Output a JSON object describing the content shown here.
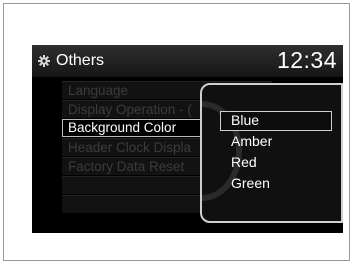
{
  "header": {
    "title": "Others",
    "clock": "12:34",
    "icon": "gear-icon"
  },
  "menu": {
    "items": [
      {
        "label": "Language",
        "state": "dimmed"
      },
      {
        "label": "Display Operation - (",
        "state": "dimmed"
      },
      {
        "label": "Background Color",
        "state": "active"
      },
      {
        "label": "Header Clock Displa",
        "state": "dimmed"
      },
      {
        "label": "Factory Data Reset",
        "state": "dimmed"
      },
      {
        "label": "",
        "state": "empty"
      },
      {
        "label": "",
        "state": "empty"
      }
    ]
  },
  "color_popup": {
    "options": [
      {
        "label": "Blue",
        "selected": true
      },
      {
        "label": "Amber",
        "selected": false
      },
      {
        "label": "Red",
        "selected": false
      },
      {
        "label": "Green",
        "selected": false
      }
    ]
  },
  "colors": {
    "screen_bg": "#000000",
    "text": "#ffffff",
    "dimmed_text": "#3c3c3c",
    "highlight_border": "#bdbdbd"
  }
}
